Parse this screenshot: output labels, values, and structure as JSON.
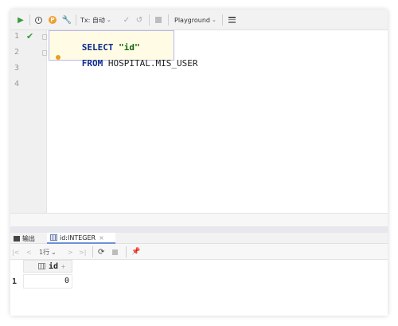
{
  "toolbar": {
    "run_icon": "play-icon",
    "history_icon": "clock-icon",
    "profile_icon": "p-badge-icon",
    "settings_icon": "wrench-icon",
    "tx_label": "Tx: 自动",
    "commit_icon": "check-icon",
    "rollback_icon": "undo-icon",
    "stop_icon": "stop-icon",
    "mode_label": "Playground",
    "table_icon": "table-icon"
  },
  "editor": {
    "line_numbers": [
      "1",
      "2",
      "3",
      "4"
    ],
    "line1": {
      "keyword": "SELECT",
      "value": "\"id\""
    },
    "line2": {
      "keyword": "FROM",
      "value": "HOSPITAL.MIS_USER"
    }
  },
  "results": {
    "output_tab": "输出",
    "result_tab": "id:INTEGER",
    "close_glyph": "×",
    "rows_label": "1行",
    "columns": [
      {
        "name": "id",
        "sort_glyph": "÷"
      }
    ],
    "rows": [
      {
        "num": "1",
        "id": "0"
      }
    ]
  },
  "colors": {
    "keyword": "#0b2a8a",
    "string": "#10650d",
    "run_green": "#3a9a3a",
    "selection_border": "#b9b7ea"
  }
}
